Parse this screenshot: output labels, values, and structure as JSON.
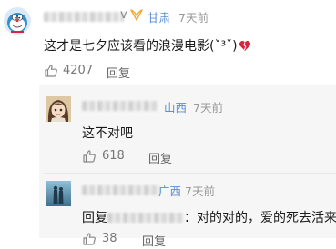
{
  "comment": {
    "username": "v",
    "badge_icon": "wings-badge-icon",
    "location": "甘肃",
    "time": "7天前",
    "text": "这才是七夕应该看的浪漫电影(ˇ³ˇ)",
    "likes": "4207",
    "reply_label": "回复"
  },
  "replies": [
    {
      "location": "山西",
      "time": "7天前",
      "text": "这不对吧",
      "likes": "618",
      "reply_label": "回复"
    },
    {
      "location": "广西",
      "time": "7天前",
      "reply_prefix": "回复",
      "text_after": "：对的对的，爱的死去活来",
      "likes": "38",
      "reply_label": "回复"
    }
  ],
  "colors": {
    "location": "#5b8fd6",
    "badge": "#f0a830",
    "heart": "#d8243c",
    "reply_bg": "#f6f6f6"
  }
}
